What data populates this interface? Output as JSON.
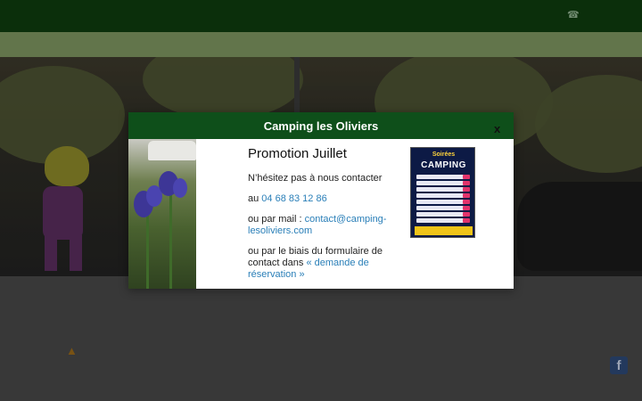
{
  "modal": {
    "title": "Camping les Oliviers",
    "close_label": "x",
    "heading": "Promotion Juillet",
    "line1": "N’hésitez pas à nous contacter",
    "phone_prefix": "au ",
    "phone": "04 68 83 12 86",
    "mail_prefix": "ou par mail : ",
    "email": "contact@camping-lesoliviers.com",
    "form_prefix": "ou par le biais du formulaire de contact dans ",
    "form_link": "« demande de réservation »",
    "poster": {
      "title": "Soirées",
      "big": "CAMPING"
    }
  },
  "colors": {
    "header_green": "#0e4f1a",
    "link_blue": "#2a7fb8",
    "topbar": "#0f3d0f",
    "navbar": "#7e9660"
  }
}
